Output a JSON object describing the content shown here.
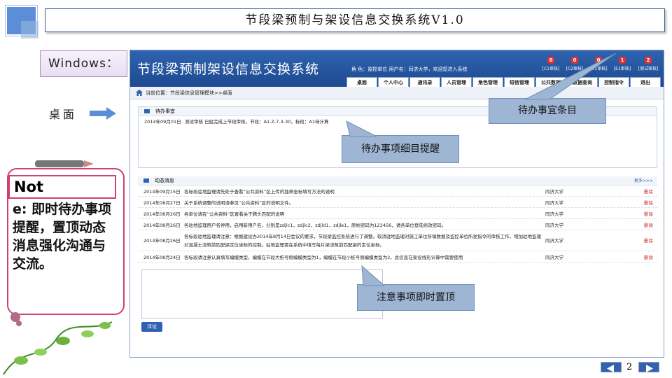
{
  "slide": {
    "title": "节段梁预制与架设信息交换系统V1.0",
    "windows_label": "Windows：",
    "desktop_label": "桌面",
    "note_head": "Not",
    "note_body": "e: 即时待办事项提醒，置顶动态消息强化沟通与交流。",
    "page_number": "2"
  },
  "app": {
    "title": "节段梁预制架设信息交换系统",
    "user_info": "角 色：监控单位    用户名：同济大学，欢迎您进入系统",
    "badges": [
      {
        "count": "0",
        "label": "[C1审核]"
      },
      {
        "count": "0",
        "label": "[C2审核]"
      },
      {
        "count": "0",
        "label": "[D1审核]"
      },
      {
        "count": "1",
        "label": "[E1审核]"
      },
      {
        "count": "2",
        "label": "[测试审核]"
      }
    ],
    "nav": [
      "桌面",
      "个人中心",
      "通讯录",
      "人员管理",
      "角色管理",
      "短信管理",
      "公共数据",
      "数据查询",
      "控制指令",
      "退出"
    ],
    "breadcrumb": "当前位置：节段梁信息管理模块>>桌面",
    "todo": {
      "heading": "待办事宜",
      "items": [
        {
          "date": "2014年09月01日",
          "text": "测试审核 已经完成上节段审核，节段：A1-Z-7-3-30，标段：A1待计算"
        }
      ]
    },
    "news": {
      "heading": "动态消息",
      "more": "更多>>>",
      "items": [
        {
          "date": "2014年09月15日",
          "text": "各标段驻地监理请先处于查看“公共资料”区上传的独样坐标填写方法的说明",
          "org": "同济大学",
          "del": "删除"
        },
        {
          "date": "2014年08月27日",
          "text": "关于系统调整的说明请参见“公共资料”区的说明文件。",
          "org": "同济大学",
          "del": "删除"
        },
        {
          "date": "2014年08月26日",
          "text": "各单位请在“公共资料”区查看关于腾头匹配的说明",
          "org": "同济大学",
          "del": "删除"
        },
        {
          "date": "2014年08月26日",
          "text": "各驻地监理用户名停用，启用新用户名，分别是zdjlc1，zdjlc2，zdjld1，zdjle1，原始密码为123456，请各单位登陆修改密码。",
          "org": "同济大学",
          "del": "删除"
        },
        {
          "date": "2014年08月26日",
          "text": "各标段驻地监理请注意：根据建设办2014年8月14日会议的要求，节段梁监控系统进行了调整。取消驻地监理对施工单位所填数据及监控单位所发指令的审核工作，增加驻地监理对混凝土浇筑前匹配梁定位坐标的控制。驻地监理需在系统中填写每片梁浇筑前匹配梁的定位坐标。",
          "org": "同济大学",
          "del": "删除"
        },
        {
          "date": "2014年08月24日",
          "text": "各标段请注意认真填写编模类型，编模在节段大桩号侧编模类型为1，编模在节段小桩号侧编模类型为2，此信息在架设线形计算中需要使用",
          "org": "同济大学",
          "del": "删除"
        }
      ]
    },
    "comment_button": "评论"
  },
  "callouts": {
    "todo_items": "待办事宜条目",
    "todo_reminder": "待办事项细目提醒",
    "pinned": "注意事项即时置顶"
  }
}
